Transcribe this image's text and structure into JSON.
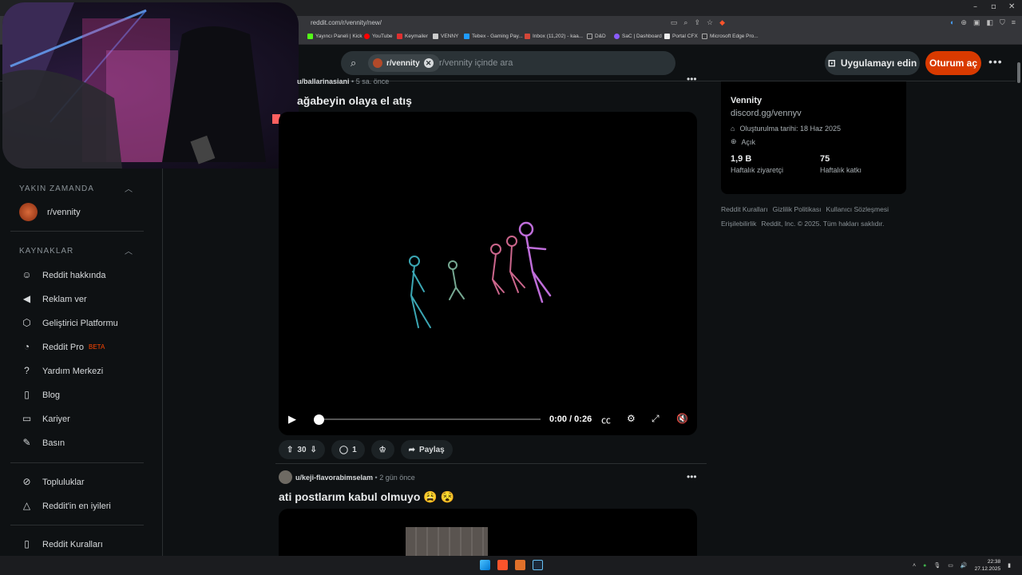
{
  "browser": {
    "url": "reddit.com/r/vennity/new/",
    "window_controls": [
      "–",
      "▫",
      "✕"
    ],
    "bookmarks": [
      {
        "label": "Yayıncı Paneli | Kick",
        "color": "#53fc18"
      },
      {
        "label": "YouTube",
        "color": "#ff0000"
      },
      {
        "label": "Keymailer",
        "color": "#e03030"
      },
      {
        "label": "VENNY",
        "color": "#cccccc"
      },
      {
        "label": "Tebex - Gaming Pay...",
        "color": "#1e9bff"
      },
      {
        "label": "Inbox (11,202) - kaa...",
        "color": "#d44638"
      },
      {
        "label": "D&D",
        "color": "#aaaaaa"
      },
      {
        "label": "SaC | Dashboard",
        "color": "#8a5cff"
      },
      {
        "label": "Portal CFX",
        "color": "#eeeeee"
      },
      {
        "label": "Microsoft Edge Pro...",
        "color": "#aaaaaa"
      }
    ]
  },
  "header": {
    "search_chip": "r/vennity",
    "search_placeholder": "r/vennity içinde ara",
    "get_app": "Uygulamayı edin",
    "login": "Oturum aç",
    "more": "•••"
  },
  "sidebar": {
    "recent_title": "YAKIN ZAMANDA",
    "recent_items": [
      {
        "label": "r/vennity"
      }
    ],
    "resources_title": "KAYNAKLAR",
    "resources": [
      {
        "label": "Reddit hakkında",
        "icon": "reddit-icon"
      },
      {
        "label": "Reklam ver",
        "icon": "megaphone-icon"
      },
      {
        "label": "Geliştirici Platformu",
        "icon": "developer-icon"
      },
      {
        "label": "Reddit Pro",
        "icon": "pro-icon",
        "badge": "BETA"
      },
      {
        "label": "Yardım Merkezi",
        "icon": "help-icon"
      },
      {
        "label": "Blog",
        "icon": "book-icon"
      },
      {
        "label": "Kariyer",
        "icon": "briefcase-icon"
      },
      {
        "label": "Basın",
        "icon": "press-icon"
      }
    ],
    "communities": [
      {
        "label": "Topluluklar",
        "icon": "communities-icon"
      },
      {
        "label": "Reddit'in en iyileri",
        "icon": "best-icon"
      }
    ],
    "rules": {
      "label": "Reddit Kuralları",
      "icon": "rules-icon"
    }
  },
  "posts": [
    {
      "author": "u/ballarinasiani",
      "time": "5 sa. önce",
      "title": "ağabeyin olaya el atış",
      "video": {
        "time": "0:00 / 0:26",
        "progress": 0
      },
      "upvotes": "30",
      "comments": "1",
      "share": "Paylaş"
    },
    {
      "author": "u/keji-flavorabimselam",
      "time": "2 gün önce",
      "title": "ati postlarım kabul olmuyo 😩 😵"
    }
  ],
  "community_card": {
    "name": "Vennity",
    "link": "discord.gg/vennyv",
    "created": "Oluşturulma tarihi: 18 Haz 2025",
    "visibility": "Açık",
    "weekly_visitors_value": "1,9 B",
    "weekly_visitors_label": "Haftalık ziyaretçi",
    "weekly_contrib_value": "75",
    "weekly_contrib_label": "Haftalık katkı"
  },
  "footer": {
    "row1": [
      "Reddit Kuralları",
      "Gizlilik Politikası",
      "Kullanıcı Sözleşmesi"
    ],
    "row2": [
      "Erişilebilirlik",
      "Reddit, Inc. © 2025. Tüm hakları saklıdır."
    ]
  },
  "taskbar": {
    "time": "22:38",
    "date": "27.12.2025"
  }
}
